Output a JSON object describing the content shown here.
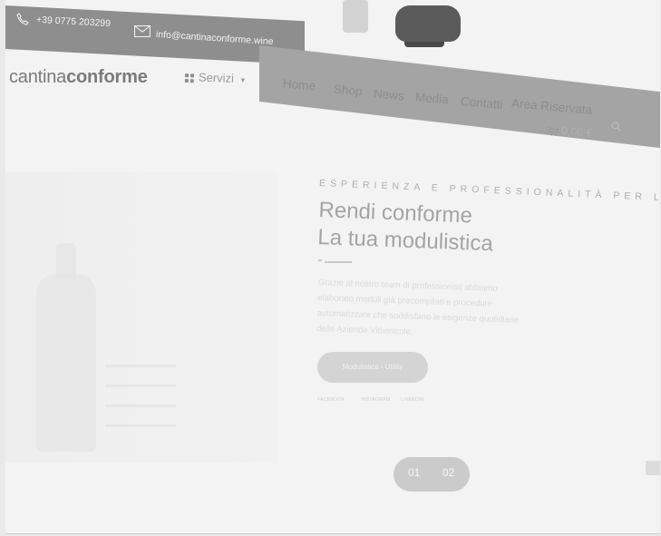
{
  "topbar": {
    "phone": "+39 0775 203299",
    "email": "info@cantinaconforme.wine",
    "phone_icon": "phone-icon",
    "mail_icon": "mail-icon"
  },
  "brand": {
    "logo_light": "cantina",
    "logo_bold": "conforme"
  },
  "nav": {
    "servizi": "Servizi",
    "servizi_caret": "▾",
    "items": [
      "Home",
      "Shop",
      "News",
      "Media",
      "Contatti",
      "Area Riservata"
    ],
    "cart_icon": "cart-icon",
    "cart_total": "0,00 €",
    "search_icon": "search-icon"
  },
  "hero": {
    "eyebrow": "ESPERIENZA E PROFESSIONALITÀ PER L'AZIE",
    "title_line1": "Rendi conforme",
    "title_line2": "La tua modulistica",
    "body": "Grazie al nostro team di professionisti abbiamo elaborato moduli già precompilati e procedure automatizzate che soddisfano le esigenze quotidiane delle Aziende Vitivinicole.",
    "cta_label": "Modulistica - Utility",
    "social": [
      "FACEBOOK",
      "INSTAGRAM",
      "LINKEDIN"
    ]
  },
  "slider": {
    "dots": [
      "01",
      "02"
    ],
    "active_index": 0
  },
  "colors": {
    "topbar": "#8e8e8e",
    "nav_bar": "#a4a4a4",
    "text_gray": "#8d8d8d",
    "button": "#d4d4d4"
  }
}
